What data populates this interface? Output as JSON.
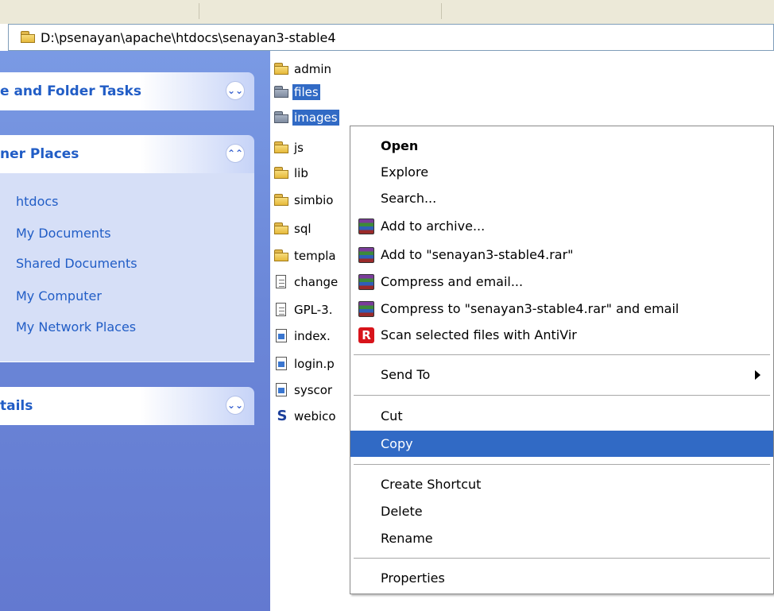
{
  "address": {
    "path": "D:\\psenayan\\apache\\htdocs\\senayan3-stable4"
  },
  "taskpane": {
    "file_folder_tasks": {
      "title": "e and Folder Tasks"
    },
    "other_places": {
      "title": "ner Places",
      "items": [
        "htdocs",
        "My Documents",
        "Shared Documents",
        "My Computer",
        "My Network Places"
      ]
    },
    "details": {
      "title": "tails"
    }
  },
  "files": [
    {
      "name": "admin",
      "icon": "folder-icon"
    },
    {
      "name": "files",
      "icon": "folder-icon"
    },
    {
      "name": "images",
      "icon": "folder-icon"
    },
    {
      "name": "js",
      "icon": "folder-icon"
    },
    {
      "name": "lib",
      "icon": "folder-icon"
    },
    {
      "name": "simbio",
      "icon": "folder-icon"
    },
    {
      "name": "sql",
      "icon": "folder-icon"
    },
    {
      "name": "templa",
      "icon": "folder-icon"
    },
    {
      "name": "change",
      "icon": "text-file-icon"
    },
    {
      "name": "GPL-3.",
      "icon": "text-file-icon"
    },
    {
      "name": "index.",
      "icon": "php-file-icon"
    },
    {
      "name": "login.p",
      "icon": "php-file-icon"
    },
    {
      "name": "syscor",
      "icon": "php-file-icon"
    },
    {
      "name": "webico",
      "icon": "web-file-icon"
    }
  ],
  "context_menu": {
    "open": "Open",
    "explore": "Explore",
    "search": "Search...",
    "add_archive": "Add to archive...",
    "add_rar": "Add to \"senayan3-stable4.rar\"",
    "compress_email": "Compress and email...",
    "compress_rar_email": "Compress to \"senayan3-stable4.rar\" and email",
    "scan": "Scan selected files with AntiVir",
    "send_to": "Send To",
    "cut": "Cut",
    "copy": "Copy",
    "create_shortcut": "Create Shortcut",
    "delete": "Delete",
    "rename": "Rename",
    "properties": "Properties"
  },
  "colors": {
    "selection": "#316ac5",
    "taskpane": "#6b87d8",
    "link": "#215dc6"
  }
}
